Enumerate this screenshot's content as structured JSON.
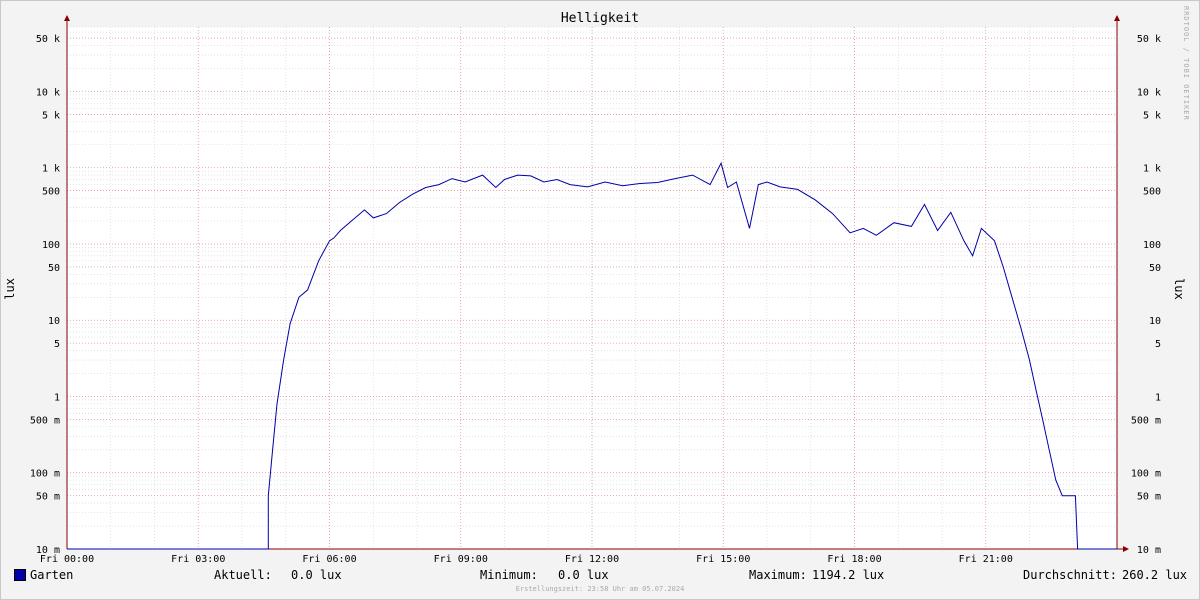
{
  "title": "Helligkeit",
  "watermark": "RRDTOOL / TOBI OETIKER",
  "unit_label": "lux",
  "legend": {
    "series_name": "Garten",
    "current_label": "Aktuell:",
    "current_value": "0.0 lux",
    "min_label": "Minimum:",
    "min_value": "0.0 lux",
    "max_label": "Maximum:",
    "max_value": "1194.2 lux",
    "avg_label": "Durchschnitt:",
    "avg_value": "260.2 lux"
  },
  "footer": "Erstellungszeit: 23:58 Uhr am 05.07.2024",
  "colors": {
    "series": "#0000aa",
    "grid_major": "#e88a8a",
    "grid_minor": "#d0d0d0",
    "axis": "#880000"
  },
  "chart_data": {
    "type": "line",
    "title": "Helligkeit",
    "ylabel": "lux",
    "yscale": "log",
    "ylim": [
      0.01,
      70000
    ],
    "xlim": [
      0,
      24
    ],
    "x_unit": "hours",
    "x_ticks": [
      {
        "x": 0,
        "label": "Fri 00:00"
      },
      {
        "x": 3,
        "label": "Fri 03:00"
      },
      {
        "x": 6,
        "label": "Fri 06:00"
      },
      {
        "x": 9,
        "label": "Fri 09:00"
      },
      {
        "x": 12,
        "label": "Fri 12:00"
      },
      {
        "x": 15,
        "label": "Fri 15:00"
      },
      {
        "x": 18,
        "label": "Fri 18:00"
      },
      {
        "x": 21,
        "label": "Fri 21:00"
      }
    ],
    "y_ticks": [
      {
        "y": 50000,
        "label": "50 k"
      },
      {
        "y": 10000,
        "label": "10 k"
      },
      {
        "y": 5000,
        "label": "5 k"
      },
      {
        "y": 1000,
        "label": "1 k"
      },
      {
        "y": 500,
        "label": "500"
      },
      {
        "y": 100,
        "label": "100"
      },
      {
        "y": 50,
        "label": "50"
      },
      {
        "y": 10,
        "label": "10"
      },
      {
        "y": 5,
        "label": "5"
      },
      {
        "y": 1,
        "label": "1"
      },
      {
        "y": 0.5,
        "label": "500 m"
      },
      {
        "y": 0.1,
        "label": "100 m"
      },
      {
        "y": 0.05,
        "label": "50 m"
      },
      {
        "y": 0.01,
        "label": "10 m"
      }
    ],
    "grid": true,
    "legend_position": "bottom",
    "series": [
      {
        "name": "Garten",
        "color": "#0000aa",
        "x": [
          0,
          4.6,
          4.6,
          4.7,
          4.8,
          4.95,
          5.1,
          5.3,
          5.5,
          5.75,
          6.0,
          6.1,
          6.25,
          6.5,
          6.8,
          7.0,
          7.3,
          7.6,
          7.9,
          8.2,
          8.5,
          8.8,
          9.1,
          9.5,
          9.8,
          10.0,
          10.3,
          10.6,
          10.9,
          11.2,
          11.5,
          11.9,
          12.3,
          12.7,
          13.1,
          13.5,
          13.9,
          14.3,
          14.7,
          14.95,
          15.1,
          15.3,
          15.6,
          15.8,
          16.0,
          16.3,
          16.7,
          17.1,
          17.5,
          17.9,
          18.2,
          18.5,
          18.9,
          19.3,
          19.6,
          19.9,
          20.2,
          20.5,
          20.7,
          20.9,
          21.2,
          21.4,
          21.6,
          21.8,
          22.0,
          22.15,
          22.3,
          22.45,
          22.6,
          22.75,
          22.9,
          23.05,
          23.1,
          23.15,
          24
        ],
        "y": [
          0.01,
          0.01,
          0.05,
          0.2,
          0.8,
          3,
          9,
          20,
          25,
          60,
          110,
          120,
          150,
          200,
          280,
          220,
          250,
          350,
          450,
          550,
          600,
          720,
          650,
          800,
          550,
          700,
          800,
          780,
          650,
          700,
          600,
          560,
          650,
          580,
          620,
          640,
          720,
          800,
          600,
          1150,
          550,
          650,
          160,
          600,
          650,
          560,
          520,
          380,
          250,
          140,
          160,
          130,
          190,
          170,
          330,
          150,
          260,
          110,
          70,
          160,
          110,
          50,
          20,
          8,
          3,
          1.2,
          0.5,
          0.2,
          0.08,
          0.05,
          0.05,
          0.05,
          0.01,
          0.01,
          0.01
        ]
      }
    ]
  }
}
